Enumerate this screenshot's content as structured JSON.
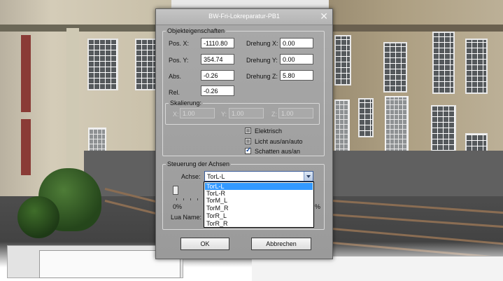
{
  "dialog": {
    "title": "BW-Fri-Lokreparatur-PB1",
    "close_glyph": "✕"
  },
  "properties": {
    "legend": "Objekteigenschaften",
    "pos_x_label": "Pos. X:",
    "pos_x_value": "-1110.80",
    "pos_y_label": "Pos. Y:",
    "pos_y_value": "354.74",
    "abs_label": "Abs.",
    "abs_value": "-0.26",
    "rel_label": "Rel.",
    "rel_value": "-0.26",
    "rot_x_label": "Drehung X:",
    "rot_x_value": "0.00",
    "rot_y_label": "Drehung Y:",
    "rot_y_value": "0.00",
    "rot_z_label": "Drehung Z:",
    "rot_z_value": "5.80"
  },
  "scaling": {
    "legend": "Skalierung:",
    "x_label": "X:",
    "x_value": "1.00",
    "y_label": "Y:",
    "y_value": "1.00",
    "z_label": "Z:",
    "z_value": "1.00"
  },
  "checkboxes": {
    "electric_label": "Elektrisch",
    "light_label": "Licht aus/an/auto",
    "shadow_label": "Schatten aus/an",
    "shadow_checked": true
  },
  "axes": {
    "legend": "Steuerung der Achsen",
    "axis_label": "Achse:",
    "selected": "TorL-L",
    "options": [
      "TorL-L",
      "TorL-R",
      "TorM_L",
      "TorM_R",
      "TorR_L",
      "TorR_R"
    ],
    "slider_min_label": "0%",
    "slider_max_label_partial": "%",
    "lua_label": "Lua Name:"
  },
  "buttons": {
    "ok_label": "OK",
    "cancel_label": "Abbrechen"
  },
  "colors": {
    "dialog_bg": "#9f9f9f",
    "selection": "#3399ff"
  }
}
